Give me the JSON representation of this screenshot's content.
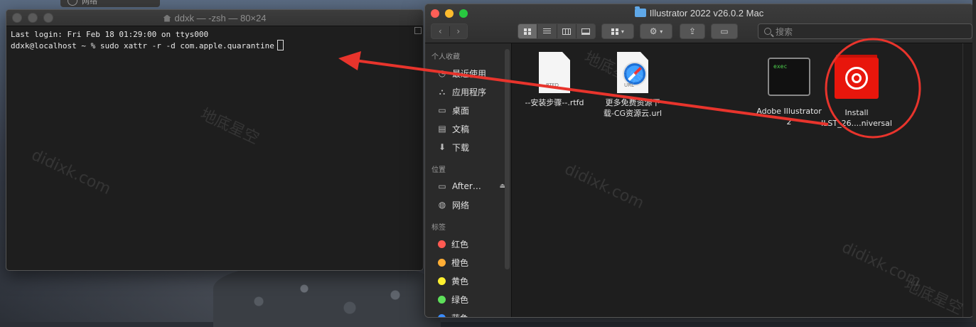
{
  "background_window": {
    "tab_label": "网络"
  },
  "terminal": {
    "title": "ddxk — -zsh — 80×24",
    "lines": [
      "Last login: Fri Feb 18 01:29:00 on ttys000",
      "ddxk@localhost ~ % sudo xattr -r -d com.apple.quarantine"
    ]
  },
  "finder": {
    "title": "Illustrator 2022 v26.0.2 Mac",
    "toolbar": {
      "back": "‹",
      "forward": "›",
      "search_placeholder": "搜索"
    },
    "sidebar": {
      "favorites_heading": "个人收藏",
      "favorites": [
        {
          "label": "最近使用",
          "icon": "clock-icon"
        },
        {
          "label": "应用程序",
          "icon": "applications-icon"
        },
        {
          "label": "桌面",
          "icon": "desktop-icon"
        },
        {
          "label": "文稿",
          "icon": "document-icon"
        },
        {
          "label": "下载",
          "icon": "download-icon"
        }
      ],
      "locations_heading": "位置",
      "locations": [
        {
          "label": "After…",
          "icon": "disk-icon"
        },
        {
          "label": "网络",
          "icon": "globe-icon"
        }
      ],
      "tags_heading": "标签",
      "tags": [
        {
          "label": "红色",
          "color": "#ff5a52"
        },
        {
          "label": "橙色",
          "color": "#ffae35"
        },
        {
          "label": "黄色",
          "color": "#fff02f"
        },
        {
          "label": "绿色",
          "color": "#5ee05a"
        },
        {
          "label": "蓝色",
          "color": "#3a8cff"
        }
      ]
    },
    "files": [
      {
        "name_line1": "--安装步骤--.rtfd",
        "name_line2": "",
        "icon": "rtfd-icon",
        "icon_tag": "RTFD"
      },
      {
        "name_line1": "更多免费资源下",
        "name_line2": "载-CG资源云.url",
        "icon": "url-icon",
        "icon_tag": "URL"
      },
      {
        "name_line1": "Adobe Illustrator",
        "name_line2": "2",
        "icon": "exec-icon",
        "icon_tag": "exec"
      },
      {
        "name_line1": "Install",
        "name_line2": "ILST_26....niversal",
        "icon": "creative-cloud-icon"
      }
    ]
  },
  "dock_hint": "绿色",
  "watermarks": [
    "didixk.com",
    "地底星空"
  ],
  "annotation_colors": {
    "arrow": "#e8342c"
  }
}
